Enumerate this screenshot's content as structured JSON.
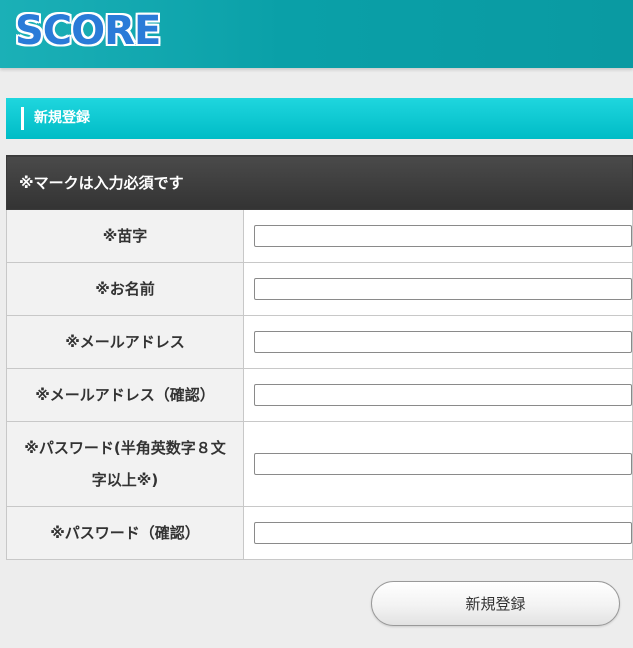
{
  "header": {
    "logo_text": "SCORE",
    "brand_color": "#2a7bd8",
    "bar_color": "#0aa0a8"
  },
  "section": {
    "title": "新規登録"
  },
  "form": {
    "notice": "※マークは入力必須です",
    "fields": [
      {
        "label": "※苗字",
        "value": ""
      },
      {
        "label": "※お名前",
        "value": ""
      },
      {
        "label": "※メールアドレス",
        "value": ""
      },
      {
        "label": "※メールアドレス（確認）",
        "value": ""
      },
      {
        "label": "※パスワード(半角英数字８文字以上※)",
        "value": ""
      },
      {
        "label": "※パスワード（確認）",
        "value": ""
      }
    ],
    "submit_label": "新規登録"
  }
}
